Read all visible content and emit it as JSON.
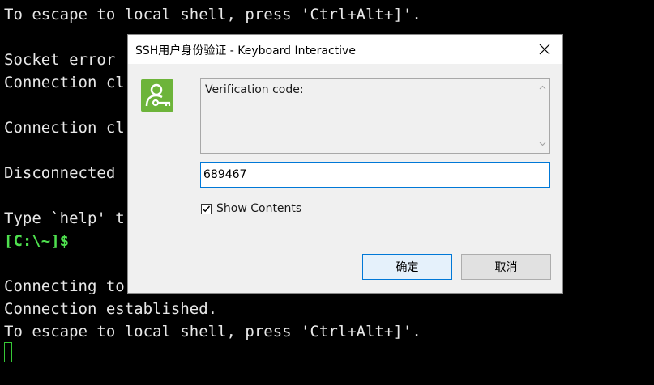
{
  "terminal": {
    "lines": [
      "To escape to local shell, press 'Ctrl+Alt+]'.",
      "",
      "Socket error",
      "Connection cl",
      "",
      "Connection cl",
      "",
      "Disconnected",
      "",
      "Type `help' t",
      "",
      "",
      "Connecting to",
      "Connection established.",
      "To escape to local shell, press 'Ctrl+Alt+]'."
    ],
    "prompt": "[C:\\~]$"
  },
  "dialog": {
    "title": "SSH用户身份验证 - Keyboard Interactive",
    "prompt_label": "Verification code:",
    "code_value": "689467",
    "show_contents_label": "Show Contents",
    "show_contents_checked": true,
    "ok_label": "确定",
    "cancel_label": "取消",
    "app_icon": "user-key-icon"
  },
  "colors": {
    "terminal_bg": "#000000",
    "prompt": "#4ee04e",
    "dialog_bg": "#f0f0f0",
    "accent": "#0078d7",
    "icon_green": "#6db43a"
  }
}
